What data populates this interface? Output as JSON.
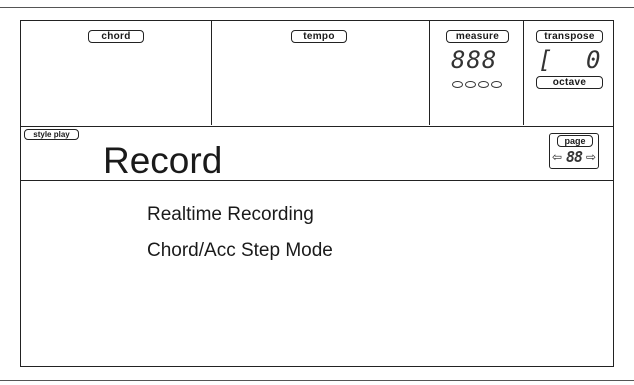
{
  "header": {
    "chord_label": "chord",
    "tempo_label": "tempo",
    "measure_label": "measure",
    "measure_display": "888",
    "measure_beats": 4,
    "transpose_label": "transpose",
    "transpose_display_left": "[",
    "transpose_display_right": "0",
    "octave_label": "octave"
  },
  "titleband": {
    "mode_label": "style play",
    "title": "Record",
    "page_label": "page",
    "page_display": "88",
    "page_left_arrow": "⇦",
    "page_right_arrow": "⇨"
  },
  "menu": {
    "items": [
      {
        "label": "Realtime Recording"
      },
      {
        "label": "Chord/Acc Step Mode"
      }
    ]
  }
}
